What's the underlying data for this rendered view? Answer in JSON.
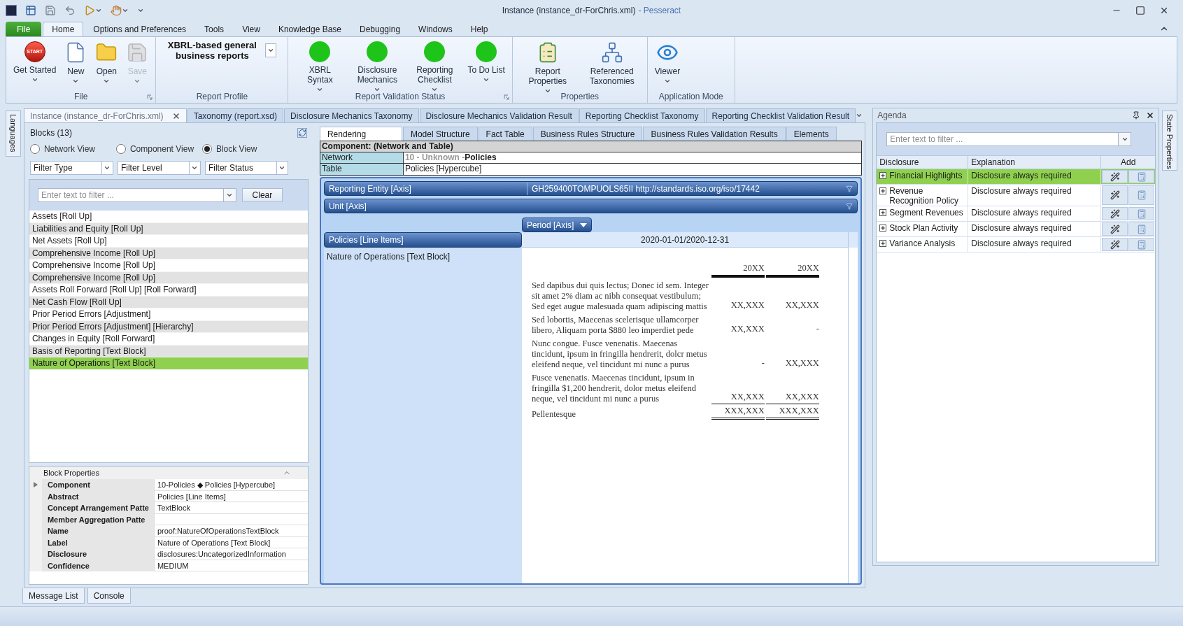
{
  "window": {
    "title": "Instance (instance_dr-ForChris.xml)",
    "app_name": "- Pesseract"
  },
  "ribbon_tabs": [
    {
      "label": "File",
      "kind": "file",
      "selected": false
    },
    {
      "label": "Home",
      "kind": "tab",
      "selected": true
    },
    {
      "label": "Options and Preferences",
      "kind": "tab",
      "selected": false
    },
    {
      "label": "Tools",
      "kind": "tab",
      "selected": false
    },
    {
      "label": "View",
      "kind": "tab",
      "selected": false
    },
    {
      "label": "Knowledge Base",
      "kind": "tab",
      "selected": false
    },
    {
      "label": "Debugging",
      "kind": "tab",
      "selected": false
    },
    {
      "label": "Windows",
      "kind": "tab",
      "selected": false
    },
    {
      "label": "Help",
      "kind": "tab",
      "selected": false
    }
  ],
  "ribbon_groups": [
    {
      "title": "File",
      "kind": "buttons",
      "launcher": true,
      "buttons": [
        {
          "label": "Get Started",
          "icon_text": "START",
          "dropdown": true,
          "disabled": false
        },
        {
          "label": "New",
          "dropdown": true,
          "disabled": false
        },
        {
          "label": "Open",
          "dropdown": true,
          "disabled": false
        },
        {
          "label": "Save",
          "dropdown": true,
          "disabled": true
        }
      ]
    },
    {
      "title": "Report Profile",
      "kind": "profile",
      "launcher": false,
      "value": "XBRL-based general business reports"
    },
    {
      "title": "Report Validation Status",
      "kind": "status",
      "launcher": true,
      "buttons": [
        {
          "label": "XBRL Syntax",
          "color": "#1fc41a",
          "dropdown": true
        },
        {
          "label": "Disclosure Mechanics",
          "color": "#1fc41a",
          "dropdown": true
        },
        {
          "label": "Reporting Checklist",
          "color": "#1fc41a",
          "dropdown": true
        },
        {
          "label": "To Do List",
          "color": "#1fc41a",
          "dropdown": true
        }
      ]
    },
    {
      "title": "Properties",
      "kind": "buttons",
      "launcher": false,
      "buttons": [
        {
          "label": "Report Properties",
          "dropdown": true,
          "disabled": false
        },
        {
          "label": "Referenced Taxonomies",
          "dropdown": false,
          "disabled": false
        }
      ]
    },
    {
      "title": "Application Mode",
      "kind": "buttons",
      "launcher": false,
      "buttons": [
        {
          "label": "Viewer",
          "dropdown": true,
          "disabled": false
        }
      ]
    }
  ],
  "side_left": {
    "label": "Languages"
  },
  "side_right": {
    "label": "State Properties"
  },
  "doc_tabs": [
    {
      "label": "Instance (instance_dr-ForChris.xml)",
      "selected": true,
      "closable": true
    },
    {
      "label": "Taxonomy (report.xsd)",
      "selected": false,
      "closable": false
    },
    {
      "label": "Disclosure Mechanics Taxonomy",
      "selected": false,
      "closable": false
    },
    {
      "label": "Disclosure Mechanics Validation Result",
      "selected": false,
      "closable": false
    },
    {
      "label": "Reporting Checklist Taxonomy",
      "selected": false,
      "closable": false
    },
    {
      "label": "Reporting Checklist Validation Result",
      "selected": false,
      "closable": false
    }
  ],
  "blocks": {
    "title": "Blocks (13)",
    "views": [
      {
        "label": "Network View",
        "selected": false
      },
      {
        "label": "Component View",
        "selected": false
      },
      {
        "label": "Block View",
        "selected": true
      }
    ],
    "filters": [
      "Filter Type",
      "Filter Level",
      "Filter Status"
    ],
    "search": {
      "placeholder": "Enter text to filter ..."
    },
    "clear_button": "Clear",
    "items": [
      {
        "label": "Assets [Roll Up]",
        "selected": false
      },
      {
        "label": "Liabilities and Equity [Roll Up]",
        "selected": false
      },
      {
        "label": "Net Assets [Roll Up]",
        "selected": false
      },
      {
        "label": "Comprehensive Income [Roll Up]",
        "selected": false
      },
      {
        "label": "Comprehensive Income [Roll Up]",
        "selected": false
      },
      {
        "label": "Comprehensive Income [Roll Up]",
        "selected": false
      },
      {
        "label": "Assets Roll Forward [Roll Up] [Roll Forward]",
        "selected": false
      },
      {
        "label": "Net Cash Flow [Roll Up]",
        "selected": false
      },
      {
        "label": "Prior Period Errors [Adjustment]",
        "selected": false
      },
      {
        "label": "Prior Period Errors [Adjustment] [Hierarchy]",
        "selected": false
      },
      {
        "label": "Changes in Equity [Roll Forward]",
        "selected": false
      },
      {
        "label": "Basis of Reporting [Text Block]",
        "selected": false
      },
      {
        "label": "Nature of Operations [Text Block]",
        "selected": true
      }
    ]
  },
  "block_properties": {
    "title": "Block Properties",
    "rows": [
      {
        "label": "Component",
        "value": "10-Policies ◆ Policies [Hypercube]",
        "expandable": true
      },
      {
        "label": "Abstract",
        "value": "Policies [Line Items]",
        "expandable": false
      },
      {
        "label": "Concept Arrangement Patte",
        "value": "TextBlock",
        "expandable": false
      },
      {
        "label": "Member Aggregation Patte",
        "expandable": false
      },
      {
        "label": "Name",
        "value": "proof:NatureOfOperationsTextBlock",
        "expandable": false
      },
      {
        "label": "Label",
        "value": "Nature of Operations [Text Block]",
        "expandable": false
      },
      {
        "label": "Disclosure",
        "value": "disclosures:UncategorizedInformation",
        "expandable": false
      },
      {
        "label": "Confidence",
        "value": "MEDIUM",
        "expandable": false
      }
    ]
  },
  "view_tabs": [
    {
      "label": "Rendering",
      "selected": true
    },
    {
      "label": "Model Structure",
      "selected": false
    },
    {
      "label": "Fact Table",
      "selected": false
    },
    {
      "label": "Business Rules Structure",
      "selected": false
    },
    {
      "label": "Business Rules Validation Results",
      "selected": false
    },
    {
      "label": "Elements",
      "selected": false
    }
  ],
  "component": {
    "title": "Component: (Network and Table)",
    "network_label": "Network",
    "network_prefix": "10 - Unknown -",
    "network_name": "Policies",
    "table_label": "Table",
    "table_value": "Policies [Hypercube]"
  },
  "axes": [
    {
      "label": "Reporting Entity [Axis]",
      "value": "GH259400TOMPUOLS65II http://standards.iso.org/iso/17442"
    },
    {
      "label": "Unit [Axis]"
    }
  ],
  "period_axis": "Period [Axis]",
  "line_items": "Policies [Line Items]",
  "period": "2020-01-01/2020-12-31",
  "row_label": "Nature of Operations [Text Block]",
  "text_block": [
    {
      "kind": "header",
      "c1": "20XX",
      "c2": "20XX"
    },
    {
      "kind": "line",
      "text": "Sed dapibus dui quis lectus; Donec id sem. Integer sit amet 2% diam ac nibh consequat vestibulum; Sed eget augue malesuada quam adipiscing mattis",
      "c1": "XX,XXX",
      "c2": "XX,XXX"
    },
    {
      "kind": "line",
      "text": "Sed lobortis, Maecenas scelerisque ullamcorper libero, Aliquam porta $880 leo imperdiet pede",
      "c1": "XX,XXX",
      "c2": "-"
    },
    {
      "kind": "line",
      "text": "Nunc congue. Fusce venenatis. Maecenas tincidunt, ipsum in fringilla hendrerit, dolcr metus eleifend neque, vel tincidunt mi nunc a purus",
      "c1": "-",
      "c2": "XX,XXX"
    },
    {
      "kind": "last",
      "text": "Fusce venenatis. Maecenas tincidunt, ipsum in fringilla $1,200 hendrerit, dolor metus eleifend neque, vel tincidunt mi nunc a purus",
      "c1": "XX,XXX",
      "c2": "XX,XXX"
    },
    {
      "kind": "total",
      "text": "Pellentesque",
      "c1": "XXX,XXX",
      "c2": "XXX,XXX"
    }
  ],
  "agenda": {
    "title": "Agenda",
    "search": {
      "placeholder": "Enter text to filter ..."
    },
    "columns": [
      "Disclosure",
      "Explanation",
      "Add"
    ],
    "rows": [
      {
        "disclosure": "Financial Highlights",
        "explanation": "Disclosure always required",
        "selected": true
      },
      {
        "disclosure": "Revenue Recognition Policy",
        "explanation": "Disclosure always required",
        "selected": false
      },
      {
        "disclosure": "Segment Revenues",
        "explanation": "Disclosure always required",
        "selected": false
      },
      {
        "disclosure": "Stock Plan Activity",
        "explanation": "Disclosure always required",
        "selected": false
      },
      {
        "disclosure": "Variance Analysis",
        "explanation": "Disclosure always required",
        "selected": false
      }
    ]
  },
  "bottom_tabs": [
    "Message List",
    "Console"
  ]
}
